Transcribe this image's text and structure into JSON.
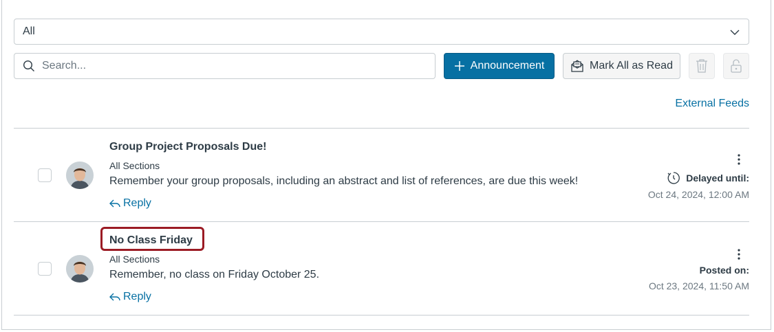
{
  "filter": {
    "selected": "All"
  },
  "search": {
    "placeholder": "Search..."
  },
  "toolbar": {
    "add_announcement_label": "Announcement",
    "mark_all_read_label": "Mark All as Read"
  },
  "external_feeds_label": "External Feeds",
  "announcements": [
    {
      "title": "Group Project Proposals Due!",
      "sections": "All Sections",
      "message": "Remember your group proposals, including an abstract and list of references, are due this week!",
      "reply_label": "Reply",
      "status_label": "Delayed until:",
      "status_date": "Oct 24, 2024, 12:00 AM"
    },
    {
      "title": "No Class Friday",
      "sections": "All Sections",
      "message": "Remember, no class on Friday October 25.",
      "reply_label": "Reply",
      "status_label": "Posted on:",
      "status_date": "Oct 23, 2024, 11:50 AM"
    }
  ],
  "colors": {
    "primary": "#0770a3",
    "text": "#2d3b45",
    "muted": "#6b7780",
    "border": "#c7cdd1",
    "highlight": "#9b1b24"
  }
}
